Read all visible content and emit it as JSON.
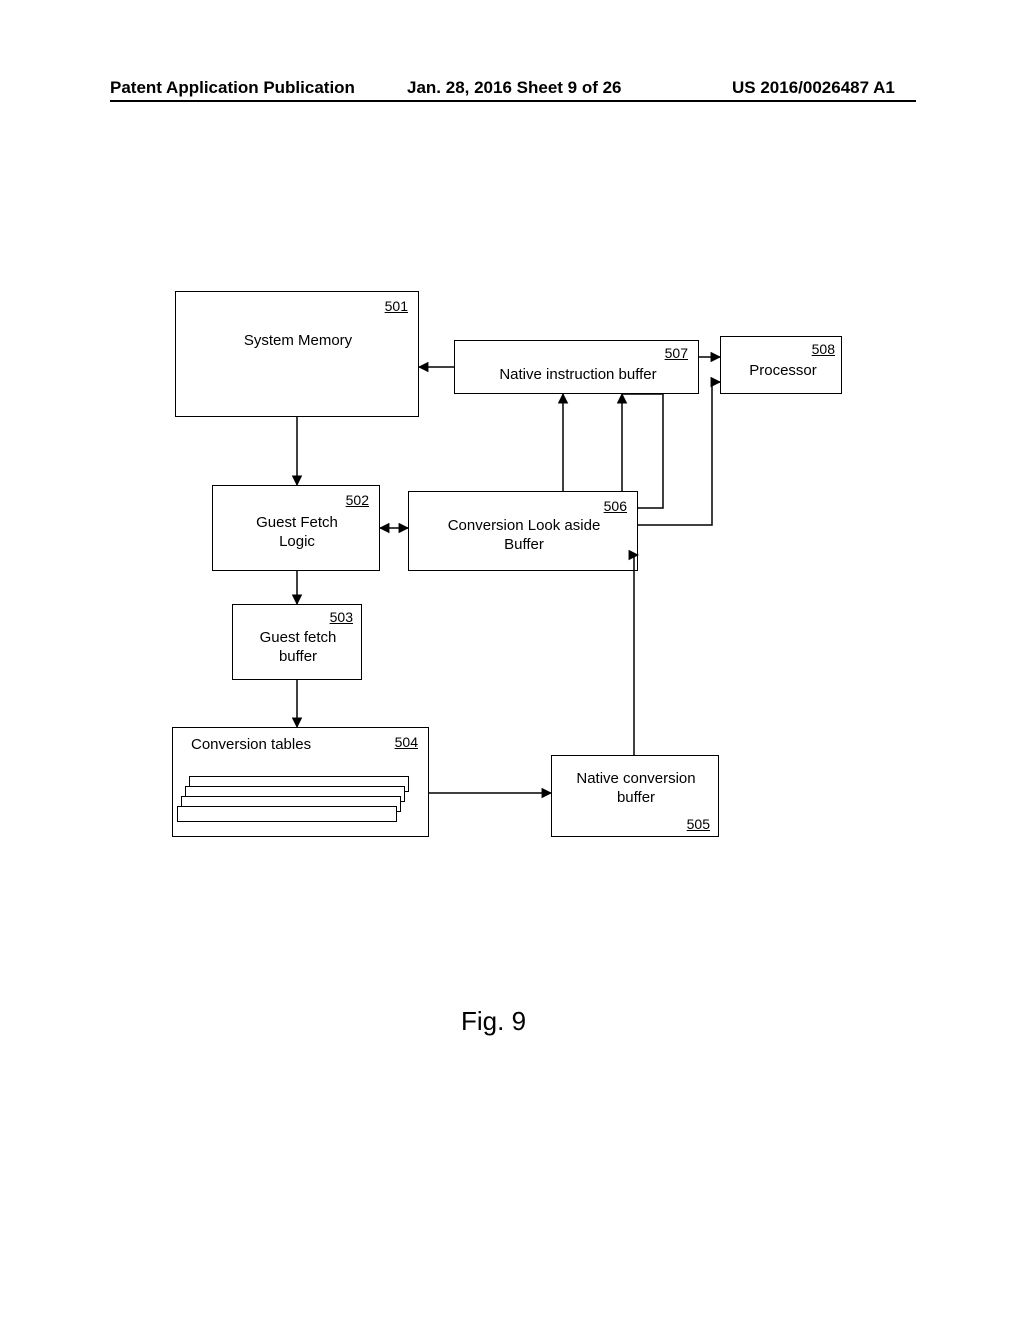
{
  "header": {
    "left": "Patent Application Publication",
    "mid": "Jan. 28, 2016  Sheet 9 of 26",
    "right": "US 2016/0026487 A1"
  },
  "boxes": {
    "sysmem": {
      "ref": "501",
      "label": "System Memory"
    },
    "nib": {
      "ref": "507",
      "label": "Native instruction buffer"
    },
    "proc": {
      "ref": "508",
      "label": "Processor"
    },
    "gfl": {
      "ref": "502",
      "label": "Guest Fetch\nLogic"
    },
    "clb": {
      "ref": "506",
      "label": "Conversion Look aside\nBuffer"
    },
    "gfb": {
      "ref": "503",
      "label": "Guest fetch\nbuffer"
    },
    "ctab": {
      "ref": "504",
      "label": "Conversion tables"
    },
    "ncb": {
      "ref": "505",
      "label": "Native conversion\nbuffer"
    }
  },
  "figure": "Fig. 9"
}
